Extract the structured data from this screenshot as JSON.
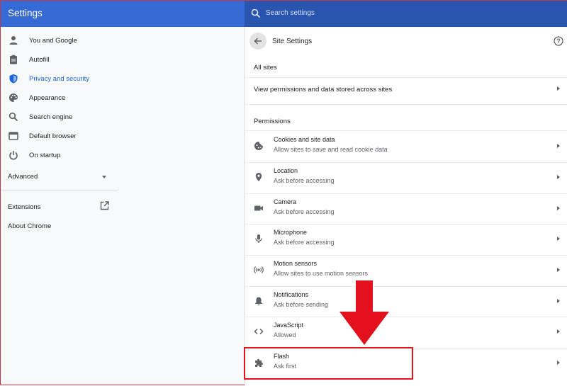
{
  "header": {
    "app_title": "Settings",
    "search_placeholder": "Search settings"
  },
  "sidebar": {
    "items": [
      {
        "label": "You and Google",
        "icon": "person-icon"
      },
      {
        "label": "Autofill",
        "icon": "clipboard-icon"
      },
      {
        "label": "Privacy and security",
        "icon": "shield-icon",
        "active": true
      },
      {
        "label": "Appearance",
        "icon": "palette-icon"
      },
      {
        "label": "Search engine",
        "icon": "search-icon"
      },
      {
        "label": "Default browser",
        "icon": "browser-icon"
      },
      {
        "label": "On startup",
        "icon": "power-icon"
      }
    ],
    "advanced_label": "Advanced",
    "extensions_label": "Extensions",
    "about_label": "About Chrome"
  },
  "panel": {
    "title": "Site Settings",
    "all_sites_heading": "All sites",
    "view_permissions_label": "View permissions and data stored across sites",
    "permissions_heading": "Permissions",
    "permissions": [
      {
        "title": "Cookies and site data",
        "subtitle": "Allow sites to save and read cookie data",
        "icon": "cookie-icon"
      },
      {
        "title": "Location",
        "subtitle": "Ask before accessing",
        "icon": "location-pin-icon"
      },
      {
        "title": "Camera",
        "subtitle": "Ask before accessing",
        "icon": "camera-icon"
      },
      {
        "title": "Microphone",
        "subtitle": "Ask before accessing",
        "icon": "microphone-icon"
      },
      {
        "title": "Motion sensors",
        "subtitle": "Allow sites to use motion sensors",
        "icon": "sensors-icon"
      },
      {
        "title": "Notifications",
        "subtitle": "Ask before sending",
        "icon": "bell-icon"
      },
      {
        "title": "JavaScript",
        "subtitle": "Allowed",
        "icon": "code-icon"
      },
      {
        "title": "Flash",
        "subtitle": "Ask first",
        "icon": "puzzle-icon"
      }
    ]
  },
  "colors": {
    "header_blue": "#3569d4",
    "search_blue": "#2a55ae",
    "active_blue": "#1a63d8",
    "annotation_red": "#e3111d"
  }
}
